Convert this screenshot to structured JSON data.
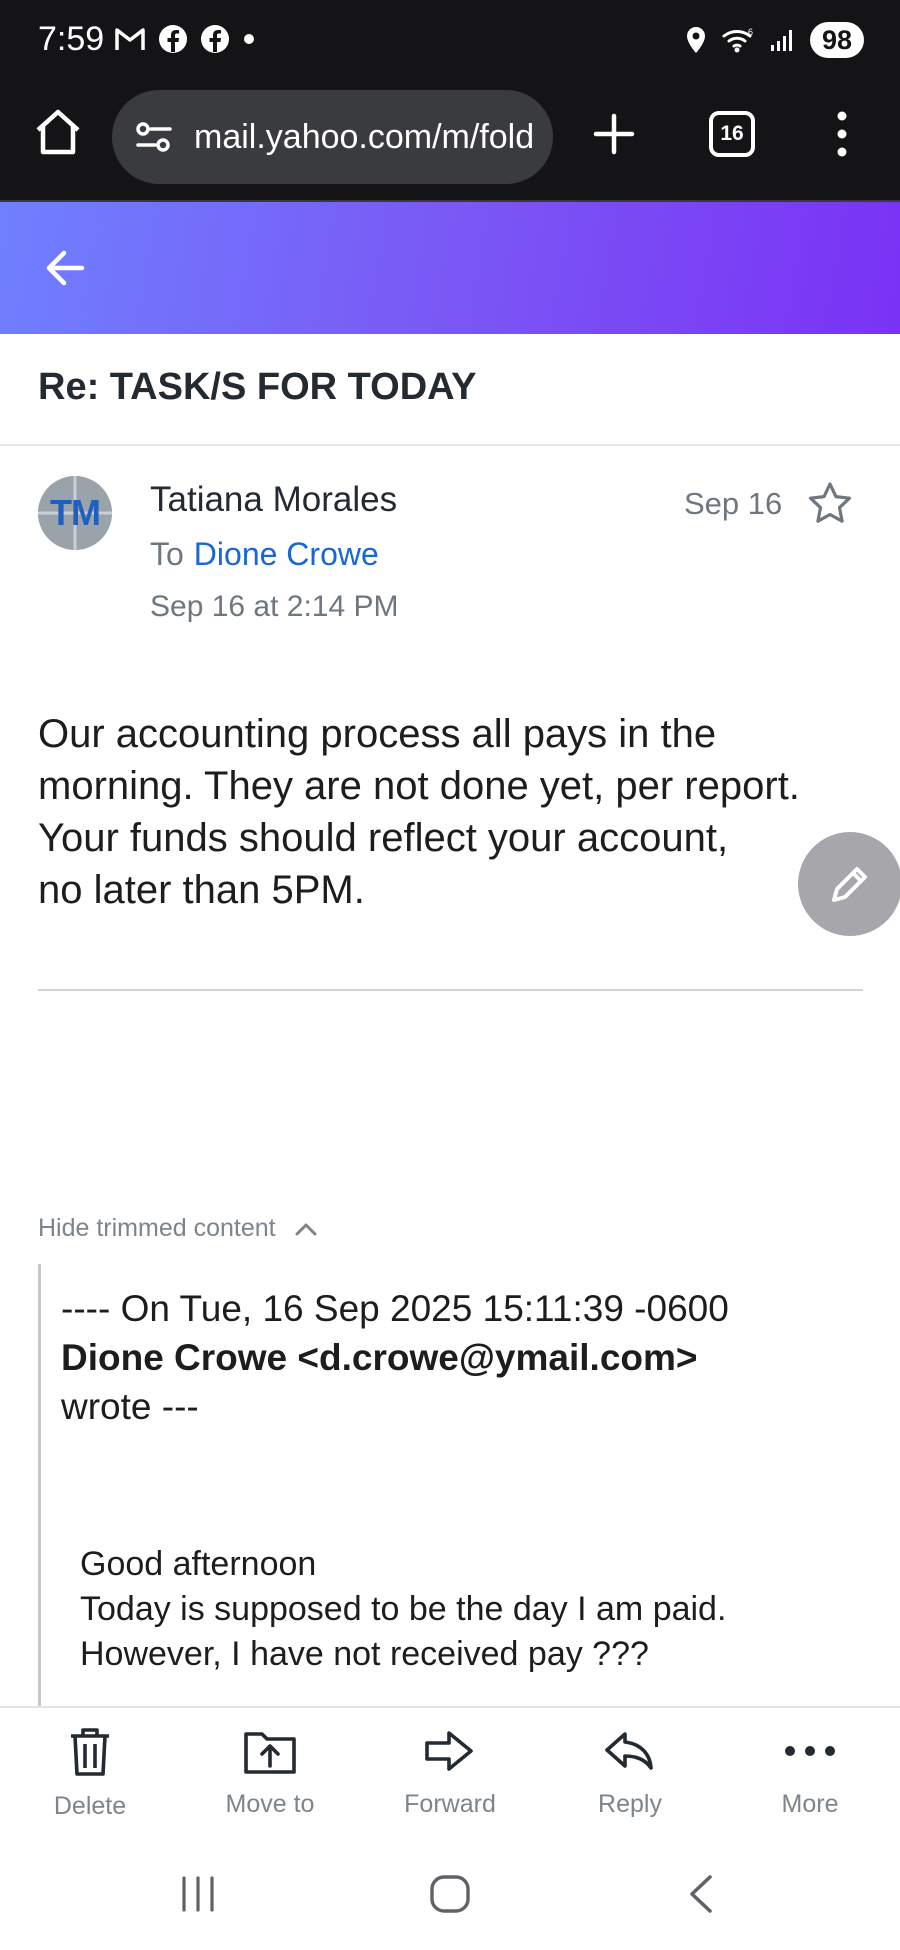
{
  "status_bar": {
    "time": "7:59",
    "battery": "98",
    "icons": [
      "gmail-icon",
      "facebook-icon",
      "facebook-icon",
      "dot-icon",
      "location-icon",
      "wifi-icon",
      "signal-icon"
    ]
  },
  "browser": {
    "url": "mail.yahoo.com/m/fold",
    "tab_count": "16",
    "icons": [
      "home-icon",
      "site-settings-icon",
      "new-tab-plus-icon",
      "tabs-icon",
      "overflow-menu-icon"
    ]
  },
  "header": {
    "gradient": [
      "#6f80ff",
      "#7a32f5"
    ]
  },
  "message": {
    "subject": "Re: TASK/S FOR TODAY",
    "avatar_initials": "TM",
    "sender_name": "Tatiana Morales",
    "to_label": "To",
    "to_recipient": "Dione Crowe",
    "sent_time": "Sep 16 at 2:14 PM",
    "date_short": "Sep 16",
    "body_lines": [
      "Our accounting process all pays in the",
      "morning. They are not done yet, per report.",
      "Your funds  should reflect your account,",
      "no later than  5PM."
    ]
  },
  "trimmed": {
    "toggle_label": "Hide trimmed content",
    "quote_header_prefix": "---- On Tue, 16 Sep 2025 15:11:39 -0600",
    "quote_header_sender": "Dione Crowe <d.crowe@ymail.com>",
    "quote_header_suffix": "wrote ---",
    "quote_lines": [
      "Good afternoon",
      "Today is supposed to be the day I am paid.",
      "However,  I have not received pay ???"
    ]
  },
  "toolbar": {
    "delete": "Delete",
    "move_to": "Move to",
    "forward": "Forward",
    "reply": "Reply",
    "more": "More"
  },
  "colors": {
    "link_blue": "#1a66d6",
    "muted_gray": "#6e7780",
    "fab_gray": "#a7a7ab"
  }
}
